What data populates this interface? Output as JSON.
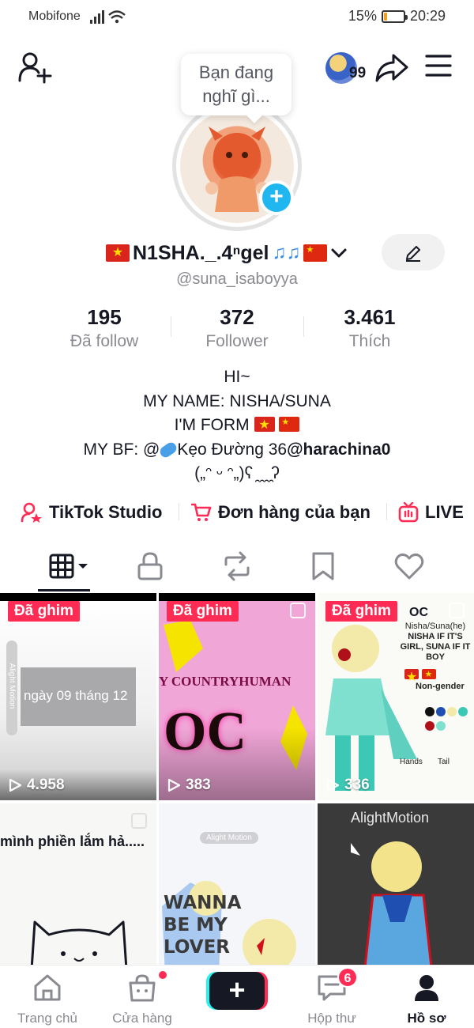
{
  "status_bar": {
    "carrier": "Mobifone",
    "battery": "15%",
    "battery_level": 0.15,
    "time": "20:29"
  },
  "top_bar": {
    "visitor_count": "99"
  },
  "avatar": {
    "note_bubble": [
      "Bạn đang",
      "nghĩ gì..."
    ]
  },
  "profile": {
    "display_name": "N1SHA._.4ⁿgel",
    "handle": "@suna_isaboyya",
    "stats": [
      {
        "value": "195",
        "label": "Đã follow"
      },
      {
        "value": "372",
        "label": "Follower"
      },
      {
        "value": "3.461",
        "label": "Thích"
      }
    ],
    "bio": {
      "line1": "HI~",
      "line2": "MY NAME: NISHA/SUNA",
      "line3": "I'M FORM",
      "line4_prefix": "MY BF: @",
      "line4_text": "Kẹo Đường 36",
      "line4_mention": "@harachina0",
      "line5": "(„ᵔ ᵕ ᵔ„)ʕ ̯ ̯ ̯ ̯ʔ"
    }
  },
  "quick_links": [
    {
      "label": "TikTok Studio"
    },
    {
      "label": "Đơn hàng của bạn"
    },
    {
      "label": "LIVE"
    }
  ],
  "videos": [
    {
      "pinned_label": "Đã ghim",
      "views": "4.958",
      "caption": "ngày 09 tháng 12",
      "watermark": "Alight Motion"
    },
    {
      "pinned_label": "Đã ghim",
      "views": "383",
      "caption": "Y COUNTRYHUMAN",
      "caption2": "OC"
    },
    {
      "pinned_label": "Đã ghim",
      "views": "336",
      "caption": "OC",
      "lines": [
        "Nisha/Suna(he)",
        "NISHA IF IT'S",
        "GIRL, SUNA IF IT",
        "BOY",
        "Non-gender",
        "Hands",
        "Tail"
      ]
    },
    {
      "caption": "mình phiền lắm hả....."
    },
    {
      "caption": "WANNA BE MY LOVER",
      "lines": [
        "WANNA",
        "BE MY",
        "LOVER"
      ],
      "watermark": "Alight Motion"
    },
    {
      "watermark": "AlightMotion"
    }
  ],
  "bottom_nav": [
    {
      "label": "Trang chủ"
    },
    {
      "label": "Cửa hàng"
    },
    {
      "label": ""
    },
    {
      "label": "Hộp thư",
      "badge": "6"
    },
    {
      "label": "Hồ sơ"
    }
  ],
  "colors": {
    "accent": "#fe2c55",
    "blue": "#20b7f0",
    "text": "#161823",
    "muted": "#8a8b91"
  }
}
